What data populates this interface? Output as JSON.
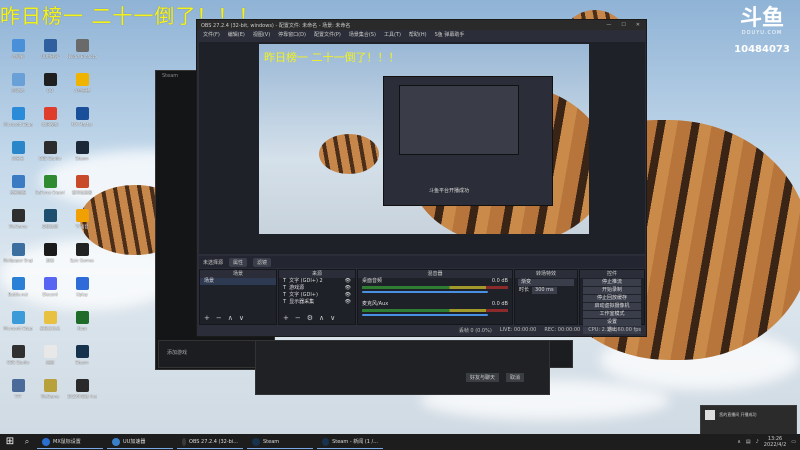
{
  "overlay": {
    "title": "昨日榜一 二十一倒了！！！"
  },
  "douyu": {
    "mark": "斗鱼",
    "sub": "DOUYU.COM",
    "room_id": "10484073"
  },
  "desktop_icons": [
    {
      "label": "此电脑",
      "color": "#4a90d9"
    },
    {
      "label": "UU加速器",
      "color": "#2f5f9e"
    },
    {
      "label": "Nvidia Broadcast",
      "color": "#6a6a6a"
    },
    {
      "label": "回收站",
      "color": "#6aa0d8"
    },
    {
      "label": "QQ",
      "color": "#1f1f1f"
    },
    {
      "label": "斗鱼直播",
      "color": "#f0b400"
    },
    {
      "label": "Microsoft Edge",
      "color": "#2b8bd8"
    },
    {
      "label": "腾讯视频",
      "color": "#e03e2d"
    },
    {
      "label": "MX Master",
      "color": "#1a4f99"
    },
    {
      "label": "网易云",
      "color": "#2a86c9"
    },
    {
      "label": "OBS Studio",
      "color": "#2c2c2c"
    },
    {
      "label": "Steam",
      "color": "#1b2838"
    },
    {
      "label": "控制面板",
      "color": "#3a7bc4"
    },
    {
      "label": "GeForce Experience",
      "color": "#2e8b30"
    },
    {
      "label": "雷神加速器",
      "color": "#c94a2a"
    },
    {
      "label": "WeGame",
      "color": "#2e2e2e"
    },
    {
      "label": "英雄联盟",
      "color": "#1f4f6f"
    },
    {
      "label": "YY语音",
      "color": "#f0a000"
    },
    {
      "label": "Wallpaper Engine",
      "color": "#3a6f9f"
    },
    {
      "label": "剪映",
      "color": "#1a1a1a"
    },
    {
      "label": "Epic Games",
      "color": "#222222"
    },
    {
      "label": "Battle.net",
      "color": "#2a7fd6"
    },
    {
      "label": "Discord",
      "color": "#5865f2"
    },
    {
      "label": "Uplay",
      "color": "#2f6bd8"
    },
    {
      "label": "Microsoft Edge",
      "color": "#3b9ad8"
    },
    {
      "label": "新建文件夹",
      "color": "#e8c042"
    },
    {
      "label": "Xbox",
      "color": "#1f6b2a"
    },
    {
      "label": "OBS Studio",
      "color": "#303030"
    },
    {
      "label": "画图",
      "color": "#e8e8e8"
    },
    {
      "label": "Steam",
      "color": "#17324d"
    },
    {
      "label": "TTT",
      "color": "#4a6a9a"
    },
    {
      "label": "WeGame",
      "color": "#b8a03a"
    },
    {
      "label": "2022年赛季 Instinct",
      "color": "#2a2a2a"
    }
  ],
  "steam": {
    "title": "Steam",
    "library_label": "添加游戏",
    "btn_friends": "好友与聊天",
    "btn_cancel": "取消"
  },
  "obs": {
    "title": "OBS 27.2.4 (32-bit, windows) - 配置文件: 未命名 - 场景: 未命名",
    "menu": [
      "文件(F)",
      "编辑(E)",
      "视图(V)",
      "停靠窗口(D)",
      "配置文件(P)",
      "场景集合(S)",
      "工具(T)",
      "帮助(H)",
      "S鱼 弹幕助手"
    ],
    "scene_bar_label": "未选择源",
    "scene_bar_props": "属性",
    "scene_bar_filters": "滤镜",
    "docks": {
      "scenes": {
        "title": "场景",
        "items": [
          "场景"
        ]
      },
      "sources": {
        "title": "来源",
        "items": [
          "文字 (GDI+) 2",
          "游戏源",
          "文字 (GDI+)",
          "显示器采集"
        ]
      },
      "mixer": {
        "title": "混音器",
        "channels": [
          {
            "name": "桌面音频",
            "db": "0.0 dB"
          },
          {
            "name": "麦克风/Aux",
            "db": "0.0 dB"
          }
        ]
      },
      "transitions": {
        "title": "转场特效",
        "mode": "渐变",
        "duration_label": "时长",
        "duration": "300 ms"
      },
      "controls": {
        "title": "控件",
        "buttons": [
          "停止推流",
          "开始录制",
          "停止回放缓存",
          "启动虚拟摄像机",
          "工作室模式",
          "设置",
          "退出"
        ]
      }
    },
    "status": {
      "dropped": "丢帧 0 (0.0%)",
      "live": "LIVE: 00:00:00",
      "rec": "REC: 00:00:00",
      "cpu": "CPU: 2.3%, 60.00 fps"
    },
    "preview_toast": "斗鱼平台开播成功"
  },
  "notification": {
    "text": "您的直播间 开播成功"
  },
  "taskbar": {
    "items": [
      {
        "label": "MX鼠标设置",
        "color": "#2a6fd0"
      },
      {
        "label": "UU加速器",
        "color": "#3a80c8"
      },
      {
        "label": "OBS 27.2.4 (32-bi...",
        "color": "#3a3a3a"
      },
      {
        "label": "Steam",
        "color": "#17324d"
      },
      {
        "label": "Steam - 新闻 (1 /...",
        "color": "#17324d"
      }
    ],
    "time": "13:26",
    "date": "2022/4/2"
  }
}
